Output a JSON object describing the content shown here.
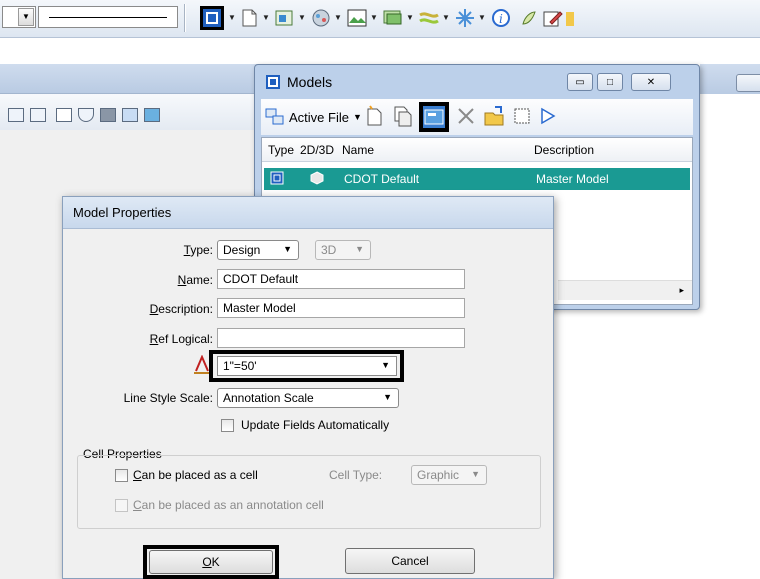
{
  "models_window": {
    "title": "Models",
    "active_file_label": "Active File",
    "columns": [
      "Type",
      "2D/3D",
      "Name",
      "Description"
    ],
    "rows": [
      {
        "name": "CDOT Default",
        "description": "Master Model"
      }
    ]
  },
  "properties_dialog": {
    "title": "Model Properties",
    "type_label": "Type:",
    "type_value": "Design",
    "dim_value": "3D",
    "name_label": "Name:",
    "name_value": "CDOT Default",
    "description_label": "Description:",
    "description_value": "Master Model",
    "ref_logical_label": "Ref Logical:",
    "ref_logical_value": "",
    "annotation_scale_value": "1\"=50'",
    "line_style_scale_label": "Line Style Scale:",
    "line_style_scale_value": "Annotation Scale",
    "update_fields_label": "Update Fields Automatically",
    "cell_properties_label": "Cell Properties",
    "placed_as_cell_label": "Can be placed as a cell",
    "cell_type_label": "Cell Type:",
    "cell_type_value": "Graphic",
    "placed_as_annotation_cell_label": "Can be placed as an annotation cell",
    "ok_label": "OK",
    "cancel_label": "Cancel"
  },
  "colors": {
    "selection": "#1a9a93",
    "highlight_border": "#000000",
    "titlebar": "#bcd0ea"
  }
}
